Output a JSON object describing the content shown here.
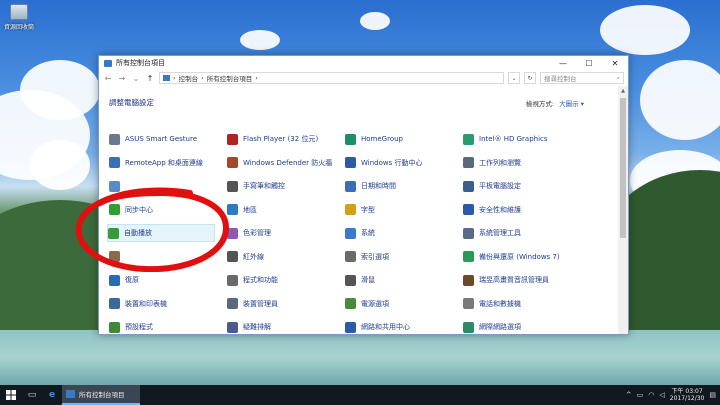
{
  "desktop": {
    "icon_label": "資源回收筒"
  },
  "window": {
    "title": "所有控制台項目",
    "minimize": "—",
    "maximize": "☐",
    "close": "✕",
    "address": {
      "crumb1": "控制台",
      "crumb2": "所有控制台項目",
      "sep": "›"
    },
    "search_placeholder": "搜尋控制台",
    "page_title": "調整電腦設定",
    "view_by_label": "檢視方式:",
    "view_by_value": "大圖示 ▾"
  },
  "items": [
    {
      "label": "ASUS Smart Gesture",
      "icon": "touchpad-icon",
      "color": "#6a7a8c"
    },
    {
      "label": "Flash Player (32 位元)",
      "icon": "flash-icon",
      "color": "#b32222"
    },
    {
      "label": "HomeGroup",
      "icon": "homegroup-icon",
      "color": "#1c8f6a"
    },
    {
      "label": "Intel® HD Graphics",
      "icon": "intel-graphics-icon",
      "color": "#2a9a72"
    },
    {
      "label": "RemoteApp 和桌面連線",
      "icon": "remoteapp-icon",
      "color": "#3a6fb5"
    },
    {
      "label": "Windows Defender 防火牆",
      "icon": "firewall-icon",
      "color": "#a34a2a"
    },
    {
      "label": "Windows 行動中心",
      "icon": "mobility-icon",
      "color": "#2a5aa8"
    },
    {
      "label": "工作列和瀏覽",
      "icon": "taskbar-icon",
      "color": "#5a6a7a"
    },
    {
      "label": "",
      "icon": "unknown-icon",
      "color": "#5a8ac8"
    },
    {
      "label": "手寫筆和觸控",
      "icon": "pen-icon",
      "color": "#555555"
    },
    {
      "label": "日期和時間",
      "icon": "clock-icon",
      "color": "#3a6fb5"
    },
    {
      "label": "平板電腦設定",
      "icon": "tablet-icon",
      "color": "#3a5f8f"
    },
    {
      "label": "同步中心",
      "icon": "sync-icon",
      "color": "#2fa02f"
    },
    {
      "label": "地區",
      "icon": "region-icon",
      "color": "#2a7ac8"
    },
    {
      "label": "字型",
      "icon": "font-icon",
      "color": "#d4a017"
    },
    {
      "label": "安全性和維護",
      "icon": "flag-icon",
      "color": "#2a5aa8"
    },
    {
      "label": "自動播放",
      "icon": "autoplay-icon",
      "color": "#3a9a3a"
    },
    {
      "label": "色彩管理",
      "icon": "color-icon",
      "color": "#8a5ab5"
    },
    {
      "label": "系統",
      "icon": "system-icon",
      "color": "#3a7ac8"
    },
    {
      "label": "系統管理工具",
      "icon": "admin-tools-icon",
      "color": "#5a6a8a"
    },
    {
      "label": "",
      "icon": "unknown2-icon",
      "color": "#8a6a4a"
    },
    {
      "label": "紅外線",
      "icon": "infrared-icon",
      "color": "#555555"
    },
    {
      "label": "索引選項",
      "icon": "index-icon",
      "color": "#6a6a6a"
    },
    {
      "label": "備份與還原 (Windows 7)",
      "icon": "backup-icon",
      "color": "#2a9a5a"
    },
    {
      "label": "復原",
      "icon": "recovery-icon",
      "color": "#2a6ab5"
    },
    {
      "label": "程式和功能",
      "icon": "programs-icon",
      "color": "#6a6a6a"
    },
    {
      "label": "滑鼠",
      "icon": "mouse-icon",
      "color": "#555555"
    },
    {
      "label": "瑞昱高畫質音訊管理員",
      "icon": "realtek-icon",
      "color": "#6a4a2a"
    },
    {
      "label": "裝置和印表機",
      "icon": "devices-icon",
      "color": "#3a6a9a"
    },
    {
      "label": "裝置管理員",
      "icon": "device-manager-icon",
      "color": "#5a6a7a"
    },
    {
      "label": "電源選項",
      "icon": "power-icon",
      "color": "#4a8a3a"
    },
    {
      "label": "電話和數據機",
      "icon": "phone-icon",
      "color": "#7a7a7a"
    },
    {
      "label": "預設程式",
      "icon": "default-programs-icon",
      "color": "#3a8a3a"
    },
    {
      "label": "疑難排解",
      "icon": "troubleshoot-icon",
      "color": "#4a5a8a"
    },
    {
      "label": "網路和共用中心",
      "icon": "network-icon",
      "color": "#2a5aa8"
    },
    {
      "label": "網際網路選項",
      "icon": "internet-options-icon",
      "color": "#2a8a6a"
    }
  ],
  "taskbar": {
    "app_label": "所有控制台項目",
    "time": "下午 03:07",
    "date": "2017/12/30"
  },
  "colors": {
    "annotation": "#e01010",
    "link": "#1f3d8f"
  }
}
